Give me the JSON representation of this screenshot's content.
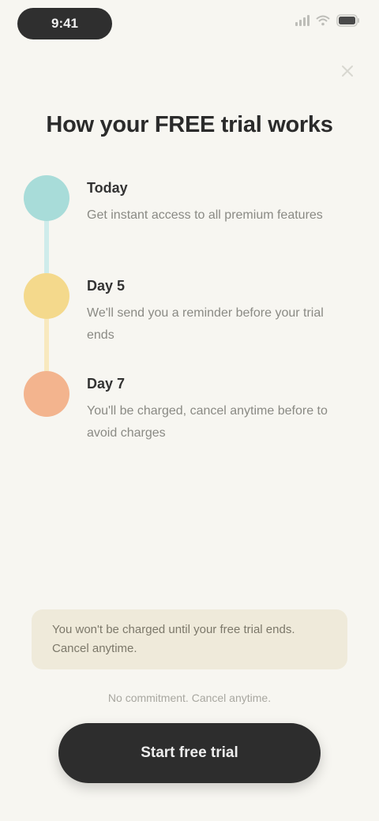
{
  "status_bar": {
    "time": "9:41"
  },
  "page": {
    "title": "How your FREE trial works"
  },
  "timeline": [
    {
      "title": "Today",
      "description": "Get instant access to all premium features",
      "color": "#a8dcd9",
      "line_color": "#cfeceb"
    },
    {
      "title": "Day 5",
      "description": "We'll send you a reminder before your trial ends",
      "color": "#f4d98c",
      "line_color": "#f8e9bf"
    },
    {
      "title": "Day 7",
      "description": "You'll be charged, cancel anytime before to avoid charges",
      "color": "#f3b48e",
      "line_color": "#f7d3bc"
    }
  ],
  "note": {
    "text": "You won't be charged until your free trial ends. Cancel anytime."
  },
  "footnote": {
    "text": "No commitment. Cancel anytime."
  },
  "cta": {
    "label": "Start free trial"
  },
  "colors": {
    "background": "#f7f6f1",
    "button": "#2d2d2d",
    "note_background": "#efeada"
  }
}
